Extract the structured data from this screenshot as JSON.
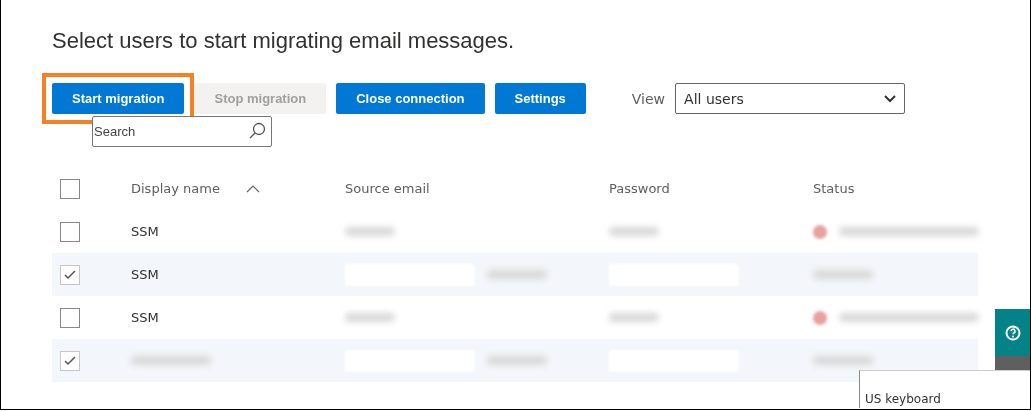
{
  "heading": "Select users to start migrating email messages.",
  "buttons": [
    {
      "label": "Start migration",
      "disabled": false,
      "highlighted": true
    },
    {
      "label": "Stop migration",
      "disabled": true,
      "highlighted": false
    },
    {
      "label": "Close connection",
      "disabled": false,
      "highlighted": false
    },
    {
      "label": "Settings",
      "disabled": false,
      "highlighted": false
    }
  ],
  "view": {
    "label": "View",
    "value": "All users"
  },
  "search": {
    "placeholder": "Search"
  },
  "table": {
    "select_all_checked": false,
    "columns": [
      {
        "label": "Display name",
        "sorted": true
      },
      {
        "label": "Source email",
        "sorted": false
      },
      {
        "label": "Password",
        "sorted": false
      },
      {
        "label": "Status",
        "sorted": false
      }
    ],
    "rows": [
      {
        "name": "SSM",
        "checked": false,
        "error": true
      },
      {
        "name": "SSM",
        "checked": true,
        "error": false
      },
      {
        "name": "SSM",
        "checked": false,
        "error": true
      },
      {
        "checked": true,
        "error": false
      }
    ]
  },
  "keyboard_popup": {
    "text": "US keyboard"
  }
}
